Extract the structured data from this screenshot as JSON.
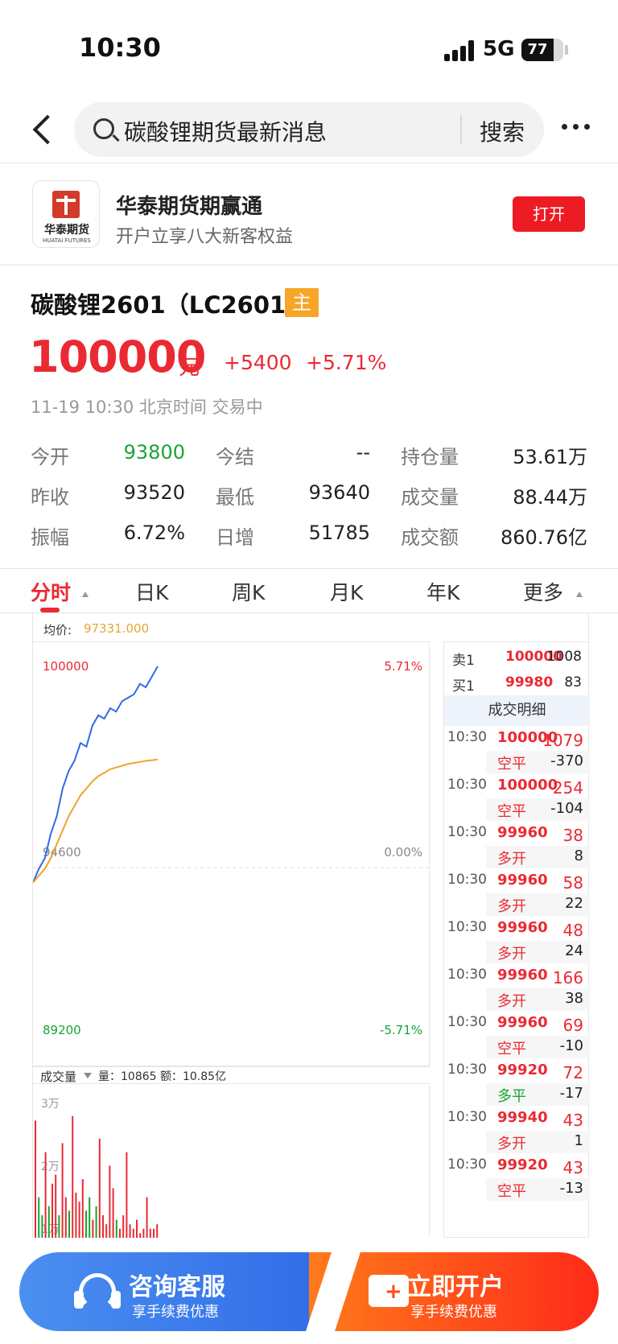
{
  "status": {
    "time": "10:30",
    "network": "5G",
    "battery": "77",
    "battery_level": 0.77
  },
  "search": {
    "query": "碳酸锂期货最新消息",
    "button": "搜索"
  },
  "ad": {
    "logo_cn": "华泰期货",
    "logo_en": "HUATAI FUTURES",
    "title": "华泰期货期赢通",
    "subtitle": "开户立享八大新客权益",
    "open_button": "打开"
  },
  "quote": {
    "name": "碳酸锂2601（LC2601）",
    "badge": "主",
    "price": "100000",
    "unit": "元",
    "change": "+5400",
    "change_pct": "+5.71%",
    "time_status": "11-19 10:30 北京时间 交易中"
  },
  "stats": [
    [
      {
        "label": "今开",
        "value": "93800"
      },
      {
        "label": "今结",
        "value": "--"
      },
      {
        "label": "持仓量",
        "value": "53.61万"
      }
    ],
    [
      {
        "label": "昨收",
        "value": "93520"
      },
      {
        "label": "最低",
        "value": "93640"
      },
      {
        "label": "成交量",
        "value": "88.44万"
      }
    ],
    [
      {
        "label": "振幅",
        "value": "6.72%"
      },
      {
        "label": "日增",
        "value": "51785"
      },
      {
        "label": "成交额",
        "value": "860.76亿"
      }
    ]
  ],
  "tabs": [
    "分时",
    "日K",
    "周K",
    "月K",
    "年K",
    "更多"
  ],
  "intraday": {
    "avg_label": "均价:",
    "avg_value": "97331.000",
    "top_price": "100000",
    "top_pct": "5.71%",
    "mid_price": "94600",
    "mid_pct": "0.00%",
    "bottom_price": "89200",
    "bottom_pct": "-5.71%",
    "volume_label": "成交量",
    "volume_info": "量：10865 额：10.85亿",
    "vol_ticks": [
      "3万",
      "2万",
      "1万"
    ]
  },
  "orderbook": {
    "sell": {
      "label": "卖1",
      "price": "100000",
      "volume": "1008"
    },
    "buy": {
      "label": "买1",
      "price": "99980",
      "volume": "83"
    }
  },
  "ticks_header": "成交明细",
  "ticks": [
    {
      "time": "10:30",
      "price": "100000",
      "volume": "1079",
      "type": "空平",
      "oi": "-370",
      "type_color": "red"
    },
    {
      "time": "10:30",
      "price": "100000",
      "volume": "254",
      "type": "空平",
      "oi": "-104",
      "type_color": "red"
    },
    {
      "time": "10:30",
      "price": "99960",
      "volume": "38",
      "type": "多开",
      "oi": "8",
      "type_color": "red"
    },
    {
      "time": "10:30",
      "price": "99960",
      "volume": "58",
      "type": "多开",
      "oi": "22",
      "type_color": "red"
    },
    {
      "time": "10:30",
      "price": "99960",
      "volume": "48",
      "type": "多开",
      "oi": "24",
      "type_color": "red"
    },
    {
      "time": "10:30",
      "price": "99960",
      "volume": "166",
      "type": "多开",
      "oi": "38",
      "type_color": "red"
    },
    {
      "time": "10:30",
      "price": "99960",
      "volume": "69",
      "type": "空平",
      "oi": "-10",
      "type_color": "red"
    },
    {
      "time": "10:30",
      "price": "99920",
      "volume": "72",
      "type": "多平",
      "oi": "-17",
      "type_color": "green"
    },
    {
      "time": "10:30",
      "price": "99940",
      "volume": "43",
      "type": "多开",
      "oi": "1",
      "type_color": "red"
    },
    {
      "time": "10:30",
      "price": "99920",
      "volume": "43",
      "type": "空平",
      "oi": "-13",
      "type_color": "red"
    }
  ],
  "cta": {
    "left_title": "咨询客服",
    "left_sub": "享手续费优惠",
    "right_title": "立即开户",
    "right_sub": "享手续费优惠"
  },
  "colors": {
    "up": "#ea2a33",
    "down": "#17a534",
    "price_line": "#2f6be8",
    "avg_line": "#f2a22b"
  },
  "chart_data": {
    "type": "line",
    "ylim": [
      89200,
      100000
    ],
    "baseline": 94600,
    "series": [
      {
        "name": "price",
        "values": [
          93800,
          94200,
          94500,
          95200,
          95700,
          96500,
          97000,
          97300,
          97800,
          97700,
          98300,
          98600,
          98500,
          98800,
          98700,
          99000,
          99100,
          99200,
          99500,
          99400,
          99700,
          100000
        ]
      },
      {
        "name": "avg",
        "values": [
          93800,
          94000,
          94200,
          94500,
          94900,
          95300,
          95700,
          96000,
          96300,
          96500,
          96700,
          96850,
          96950,
          97050,
          97100,
          97150,
          97200,
          97230,
          97260,
          97290,
          97310,
          97331
        ]
      }
    ],
    "volume": {
      "max": 30000,
      "bars": [
        {
          "v": 26000,
          "c": "r"
        },
        {
          "v": 9000,
          "c": "g"
        },
        {
          "v": 5000,
          "c": "g"
        },
        {
          "v": 19000,
          "c": "r"
        },
        {
          "v": 7000,
          "c": "g"
        },
        {
          "v": 12000,
          "c": "r"
        },
        {
          "v": 14000,
          "c": "r"
        },
        {
          "v": 5000,
          "c": "g"
        },
        {
          "v": 21000,
          "c": "r"
        },
        {
          "v": 9000,
          "c": "r"
        },
        {
          "v": 6000,
          "c": "g"
        },
        {
          "v": 27000,
          "c": "r"
        },
        {
          "v": 10000,
          "c": "r"
        },
        {
          "v": 8000,
          "c": "r"
        },
        {
          "v": 13000,
          "c": "r"
        },
        {
          "v": 6000,
          "c": "g"
        },
        {
          "v": 9000,
          "c": "g"
        },
        {
          "v": 4000,
          "c": "r"
        },
        {
          "v": 7000,
          "c": "g"
        },
        {
          "v": 22000,
          "c": "r"
        },
        {
          "v": 5000,
          "c": "r"
        },
        {
          "v": 3000,
          "c": "r"
        },
        {
          "v": 16000,
          "c": "r"
        },
        {
          "v": 11000,
          "c": "r"
        },
        {
          "v": 4000,
          "c": "g"
        },
        {
          "v": 2000,
          "c": "r"
        },
        {
          "v": 5000,
          "c": "r"
        },
        {
          "v": 19000,
          "c": "r"
        },
        {
          "v": 3000,
          "c": "r"
        },
        {
          "v": 2000,
          "c": "r"
        },
        {
          "v": 4000,
          "c": "r"
        },
        {
          "v": 1000,
          "c": "r"
        },
        {
          "v": 2000,
          "c": "r"
        },
        {
          "v": 9000,
          "c": "r"
        },
        {
          "v": 2000,
          "c": "r"
        },
        {
          "v": 2000,
          "c": "r"
        },
        {
          "v": 3000,
          "c": "r"
        }
      ]
    }
  }
}
